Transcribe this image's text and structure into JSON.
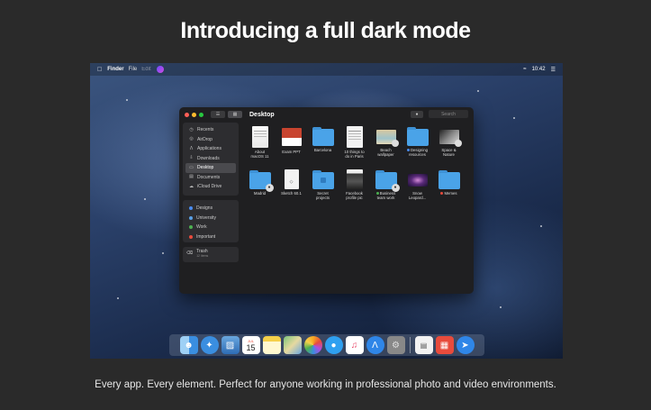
{
  "headline": "Introducing a full dark mode",
  "tagline": "Every app. Every element. Perfect for anyone working in professional photo and video environments.",
  "menubar": {
    "apple": "",
    "app": "Finder",
    "menus": [
      "File",
      "Edit"
    ],
    "time": "10:42"
  },
  "window": {
    "title": "Desktop",
    "search_placeholder": "Search",
    "sidebar": [
      {
        "label": "Recents",
        "icon": "clock-icon"
      },
      {
        "label": "AirDrop",
        "icon": "airdrop-icon"
      },
      {
        "label": "Applications",
        "icon": "applications-icon"
      },
      {
        "label": "Downloads",
        "icon": "downloads-icon"
      },
      {
        "label": "Desktop",
        "icon": "desktop-icon",
        "selected": true
      },
      {
        "label": "Documents",
        "icon": "documents-icon"
      },
      {
        "label": "iCloud Drive",
        "icon": "cloud-icon"
      }
    ],
    "tags": [
      {
        "label": "Designs",
        "color": "#4a8cf0"
      },
      {
        "label": "University",
        "color": "#5aa0e6"
      },
      {
        "label": "Work",
        "color": "#4caf50"
      },
      {
        "label": "Important",
        "color": "#e84b3c"
      }
    ],
    "trash": {
      "label": "Trash",
      "sub": "12 items"
    },
    "files": [
      {
        "line1": "About",
        "line2": "macOS 11",
        "kind": "doc"
      },
      {
        "line1": "Exam PPT",
        "line2": "",
        "kind": "ppt"
      },
      {
        "line1": "Barcelona",
        "line2": "",
        "kind": "folder"
      },
      {
        "line1": "10 things to",
        "line2": "do in Paris",
        "kind": "doc"
      },
      {
        "line1": "Beach",
        "line2": "wallpaper",
        "kind": "photo"
      },
      {
        "line1": "Designing",
        "line2": "resources",
        "kind": "folder",
        "tag": "#4a8cf0"
      },
      {
        "line1": "Space &",
        "line2": "Nature",
        "kind": "space"
      },
      {
        "line1": "Madrid",
        "line2": "",
        "kind": "folder-shared"
      },
      {
        "line1": "Sketch 60.1",
        "line2": "",
        "kind": "sketch"
      },
      {
        "line1": "Secret",
        "line2": "projects",
        "kind": "folder-lock"
      },
      {
        "line1": "Facebook",
        "line2": "profile pic",
        "kind": "portrait"
      },
      {
        "line1": "Business",
        "line2": "team work",
        "kind": "folder-shared",
        "tag": "#4caf50"
      },
      {
        "line1": "Snow",
        "line2": "Leopard...",
        "kind": "galaxy"
      },
      {
        "line1": "Memes",
        "line2": "",
        "kind": "folder",
        "tag": "#e84b3c"
      }
    ]
  },
  "dock": [
    "finder-icon",
    "safari-icon",
    "preview-icon",
    "calendar-icon",
    "notes-icon",
    "maps-icon",
    "photos-icon",
    "messages-icon",
    "music-icon",
    "appstore-icon",
    "settings-icon",
    "documents-icon",
    "news-icon",
    "messenger-icon"
  ],
  "calendar": {
    "month": "JUL",
    "day": "15"
  }
}
